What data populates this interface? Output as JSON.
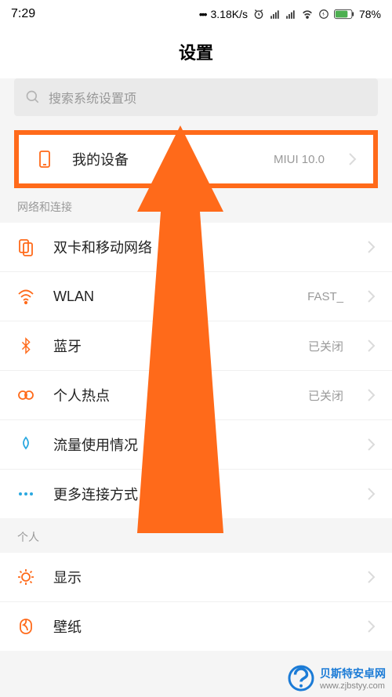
{
  "status": {
    "time": "7:29",
    "speed": "3.18K/s",
    "battery": "78%"
  },
  "title": "设置",
  "search": {
    "placeholder": "搜索系统设置项"
  },
  "mydevice": {
    "label": "我的设备",
    "value": "MIUI 10.0"
  },
  "sections": [
    {
      "header": "网络和连接",
      "items": [
        {
          "icon": "sim",
          "label": "双卡和移动网络",
          "value": ""
        },
        {
          "icon": "wifi",
          "label": "WLAN",
          "value": "FAST_"
        },
        {
          "icon": "bluetooth",
          "label": "蓝牙",
          "value": "已关闭"
        },
        {
          "icon": "hotspot",
          "label": "个人热点",
          "value": "已关闭"
        },
        {
          "icon": "data",
          "label": "流量使用情况",
          "value": ""
        },
        {
          "icon": "more",
          "label": "更多连接方式",
          "value": ""
        }
      ]
    },
    {
      "header": "个人",
      "items": [
        {
          "icon": "display",
          "label": "显示",
          "value": ""
        },
        {
          "icon": "wallpaper",
          "label": "壁纸",
          "value": ""
        }
      ]
    }
  ],
  "watermark": {
    "line1": "贝斯特安卓网",
    "line2": "www.zjbstyy.com"
  }
}
